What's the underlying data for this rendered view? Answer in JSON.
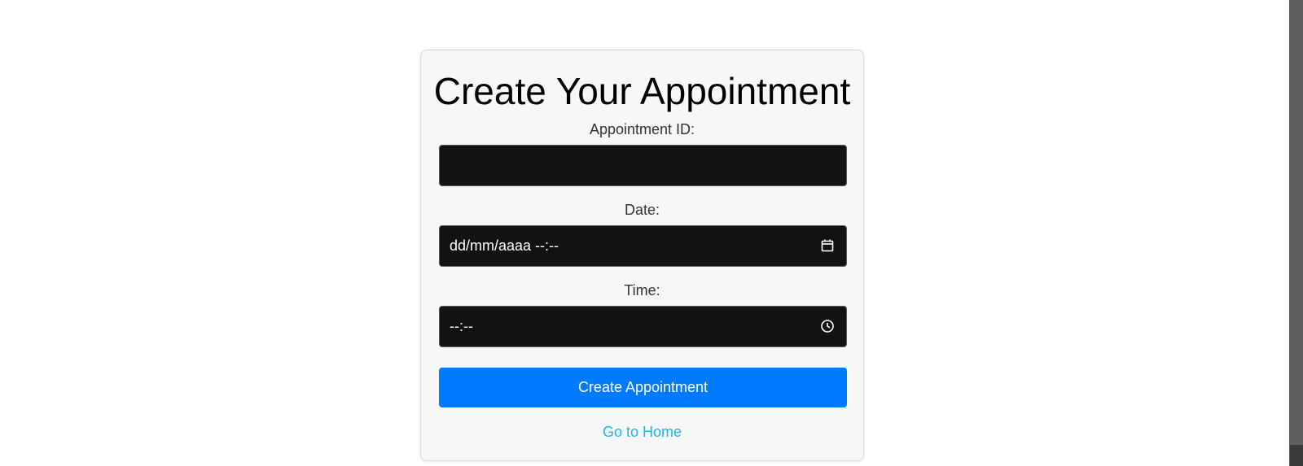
{
  "form": {
    "title": "Create Your Appointment",
    "appointment_id": {
      "label": "Appointment ID:",
      "value": ""
    },
    "date": {
      "label": "Date:",
      "value": "dd/mm/aaaa --:--",
      "icon": "calendar-icon"
    },
    "time": {
      "label": "Time:",
      "value": "--:--",
      "icon": "clock-icon"
    },
    "submit_label": "Create Appointment",
    "home_link": "Go to Home"
  },
  "colors": {
    "card_background": "#f7f7f7",
    "input_background": "#121212",
    "button_background": "#007bff",
    "link": "#1ab7f0"
  }
}
